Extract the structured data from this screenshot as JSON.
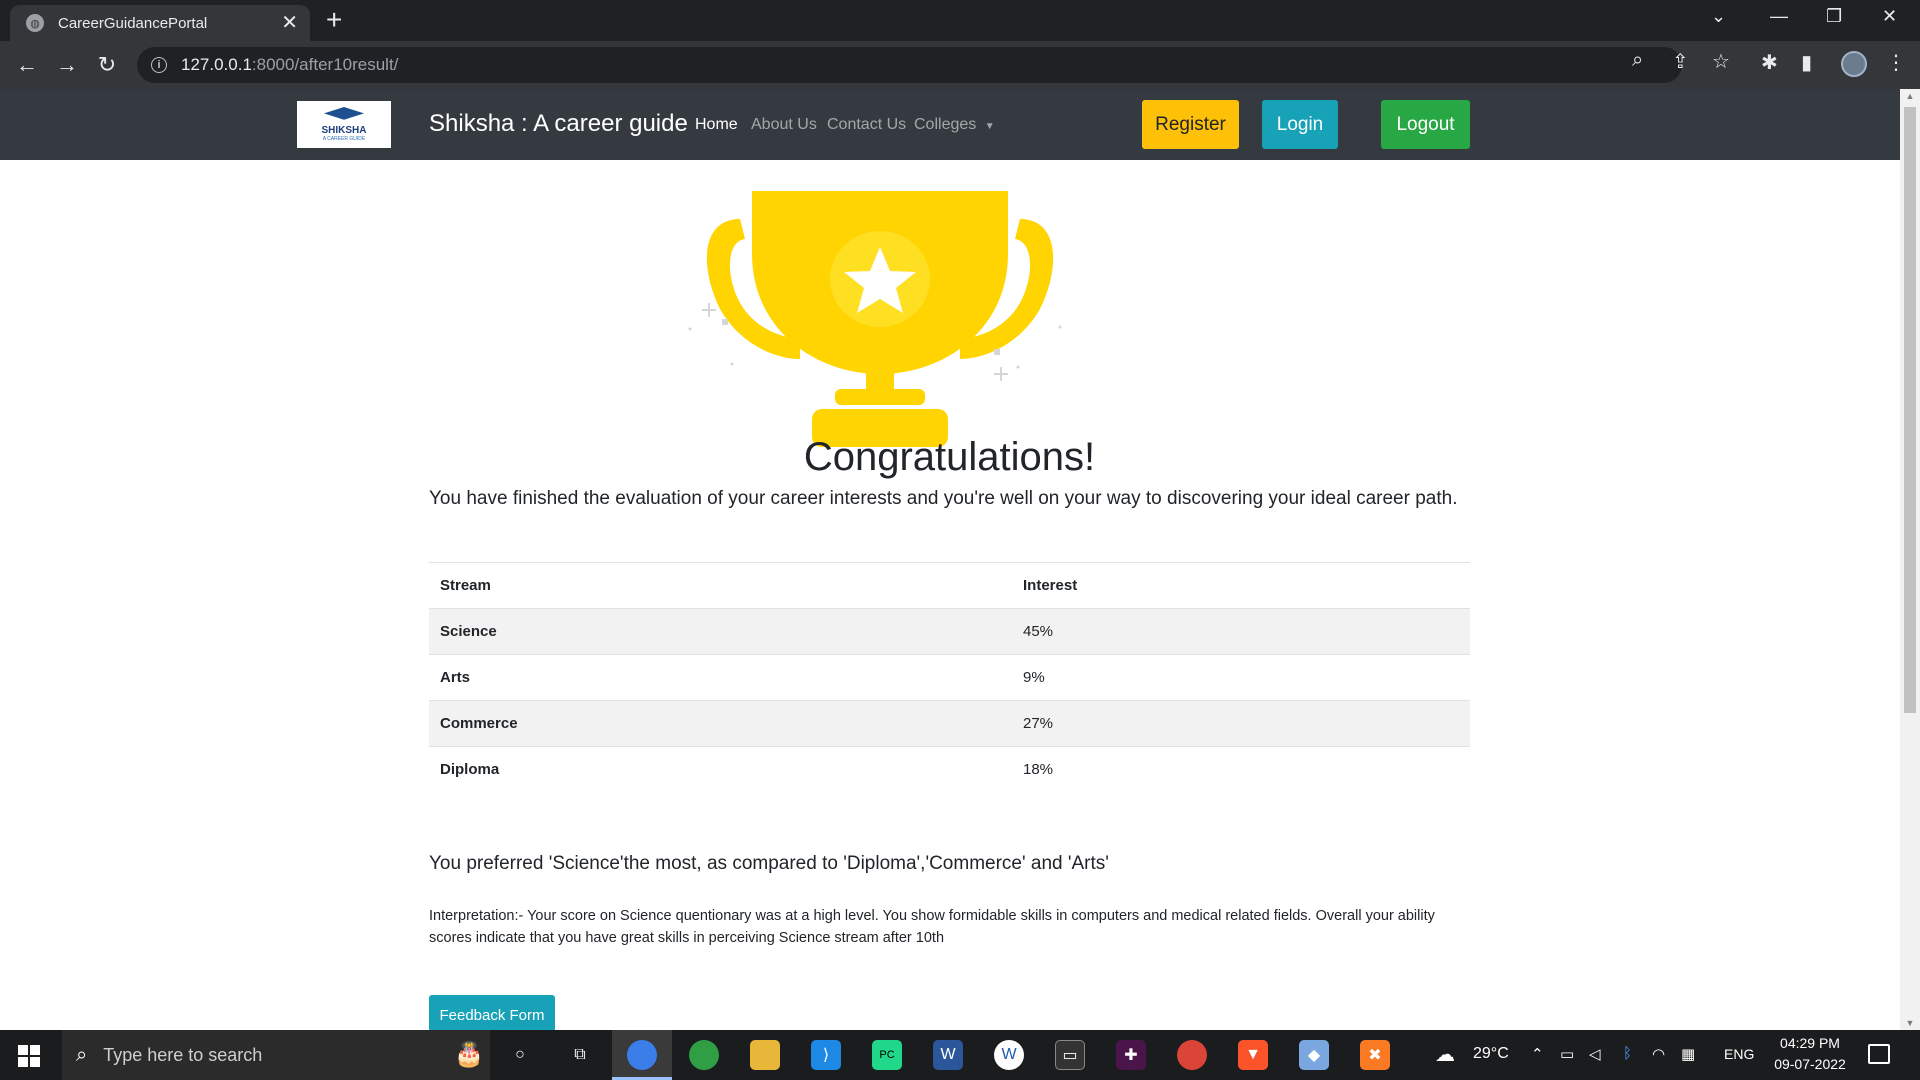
{
  "browser": {
    "tab_title": "CareerGuidancePortal",
    "tab_close": "✕",
    "new_tab": "+",
    "url_host": "127.0.0.1",
    "url_path": ":8000/after10result/",
    "window_controls": {
      "dropdown": "⌄",
      "minimize": "—",
      "restore": "❐",
      "close": "✕"
    }
  },
  "site": {
    "brand": "Shiksha : A career guide",
    "logo_text": "SHIKSHA",
    "logo_sub": "A CAREER GUIDE",
    "nav": [
      "Home",
      "About Us",
      "Contact Us",
      "Colleges"
    ],
    "buttons": {
      "register": "Register",
      "login": "Login",
      "logout": "Logout"
    }
  },
  "result": {
    "heading": "Congratulations!",
    "subtext": "You have finished the evaluation of your career interests and you're well on your way to discovering your ideal career path.",
    "table": {
      "headers": [
        "Stream",
        "Interest"
      ],
      "rows": [
        {
          "stream": "Science",
          "interest": "45%"
        },
        {
          "stream": "Arts",
          "interest": "9%"
        },
        {
          "stream": "Commerce",
          "interest": "27%"
        },
        {
          "stream": "Diploma",
          "interest": "18%"
        }
      ]
    },
    "preference": "You preferred 'Science'the most, as compared to 'Diploma','Commerce' and 'Arts'",
    "interpretation": "Interpretation:- Your score on Science quentionary was at a high level. You show formidable skills in computers and medical related fields. Overall your ability scores indicate that you have great skills in perceiving Science stream after 10th",
    "feedback_button": "Feedback Form"
  },
  "taskbar": {
    "search_placeholder": "Type here to search",
    "weather": "29°C",
    "language": "ENG",
    "time": "04:29 PM",
    "date": "09-07-2022"
  },
  "colors": {
    "navbar": "#343a40",
    "register": "#ffc107",
    "login": "#17a2b8",
    "logout": "#28a745",
    "trophy": "#ffd400"
  }
}
